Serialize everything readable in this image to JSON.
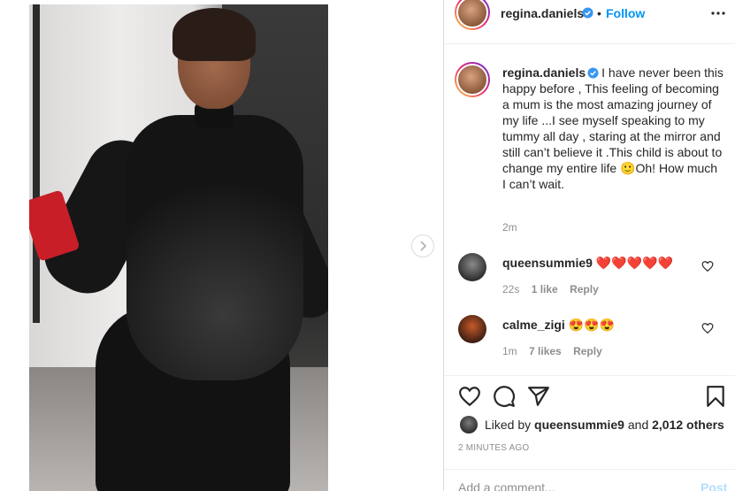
{
  "post": {
    "username": "regina.daniels",
    "separator": "•",
    "follow_label": "Follow",
    "more_icon": "more-horizontal-icon"
  },
  "caption": {
    "username": "regina.daniels",
    "text": "I have never been this happy before , This feeling of becoming a mum is the most amazing journey of my life ...I see myself speaking to my tummy all day , staring at the mirror and still can’t believe it .This child is about to change my entire life 🙂Oh! How much I can’t wait.",
    "time": "2m"
  },
  "comments": [
    {
      "username": "queensummie9",
      "text": "❤️❤️❤️❤️❤️",
      "time": "22s",
      "likes": "1 like",
      "reply_label": "Reply"
    },
    {
      "username": "calme_zigi",
      "text": "😍😍😍",
      "time": "1m",
      "likes": "7 likes",
      "reply_label": "Reply"
    }
  ],
  "likes": {
    "prefix": "Liked by",
    "user": "queensummie9",
    "conjunction": "and",
    "others": "2,012 others"
  },
  "post_age": "2 MINUTES AGO",
  "comment_box": {
    "placeholder": "Add a comment...",
    "post_label": "Post"
  },
  "colors": {
    "link_blue": "#0095f6",
    "post_disabled": "#b2dffc",
    "verified_blue": "#3897f0",
    "heart_red": "#ed4956"
  }
}
